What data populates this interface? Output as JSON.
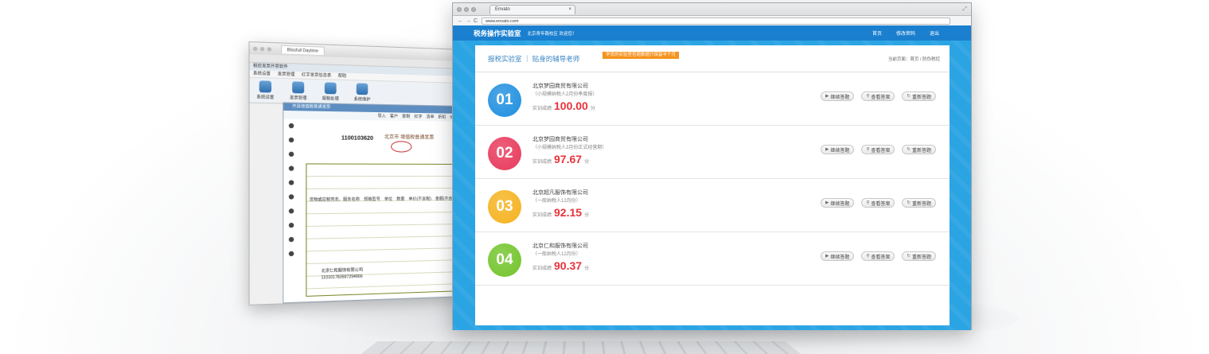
{
  "back_window": {
    "tab_title": "Blissfull Daytime",
    "app_title": "税控发票开票软件",
    "menu": [
      "系统设置",
      "发票管理",
      "红字发票信息表",
      "帮助"
    ],
    "tools": [
      "系统设置",
      "发票管理",
      "报税处理",
      "系统维护"
    ],
    "invoice_header": "开具增值税普通发票",
    "invoice_tools": [
      "导入",
      "客户",
      "复制",
      "红字",
      "清单",
      "折扣",
      "价格"
    ],
    "invoice_number": "1100103620",
    "invoice_city": "北京市",
    "invoice_type": "增值税普通发票",
    "columns": "货物或应税劳务、服务名称　规格型号　单位　数量　单价(不含税)　金额(不含税)",
    "seller_name": "北京仁和服饰有限公司",
    "seller_tax_id": "110101783587294666"
  },
  "browser": {
    "tab_title": "Envato",
    "url": "www.envato.com",
    "back": "←",
    "forward": "→",
    "reload": "C",
    "close": "×",
    "resize": "⤢"
  },
  "app": {
    "title": "税务操作实验室",
    "welcome": "北京青年路校区 欢迎您！",
    "nav": [
      "首页",
      "修改密码",
      "退出"
    ]
  },
  "panel": {
    "title": "报税实验室 ｜ 贴身的辅导老师",
    "badge": "学员的实验室答题数据只保留半个月",
    "breadcrumb": "当前页面：首页 / 防伪税控"
  },
  "score_label": "实训成绩",
  "score_unit": "分",
  "buttons": {
    "continue": "继续答题",
    "view": "查看答案",
    "redo": "重新答题"
  },
  "rows": [
    {
      "num": "01",
      "color": "#1f8fe0",
      "company": "北京梦园商贸有限公司",
      "sub": "（小规模纳税人2月份季度报）",
      "score": "100.00"
    },
    {
      "num": "02",
      "color": "#e8385a",
      "company": "北京梦园商贸有限公司",
      "sub": "（小规模纳税人3月份正式经营期）",
      "score": "97.67"
    },
    {
      "num": "03",
      "color": "#f5b21e",
      "company": "北京超凡服饰有限公司",
      "sub": "（一般纳税人12月份）",
      "score": "92.15"
    },
    {
      "num": "04",
      "color": "#72c42a",
      "company": "北京仁和服饰有限公司",
      "sub": "（一般纳税人12月份）",
      "score": "90.37"
    }
  ]
}
